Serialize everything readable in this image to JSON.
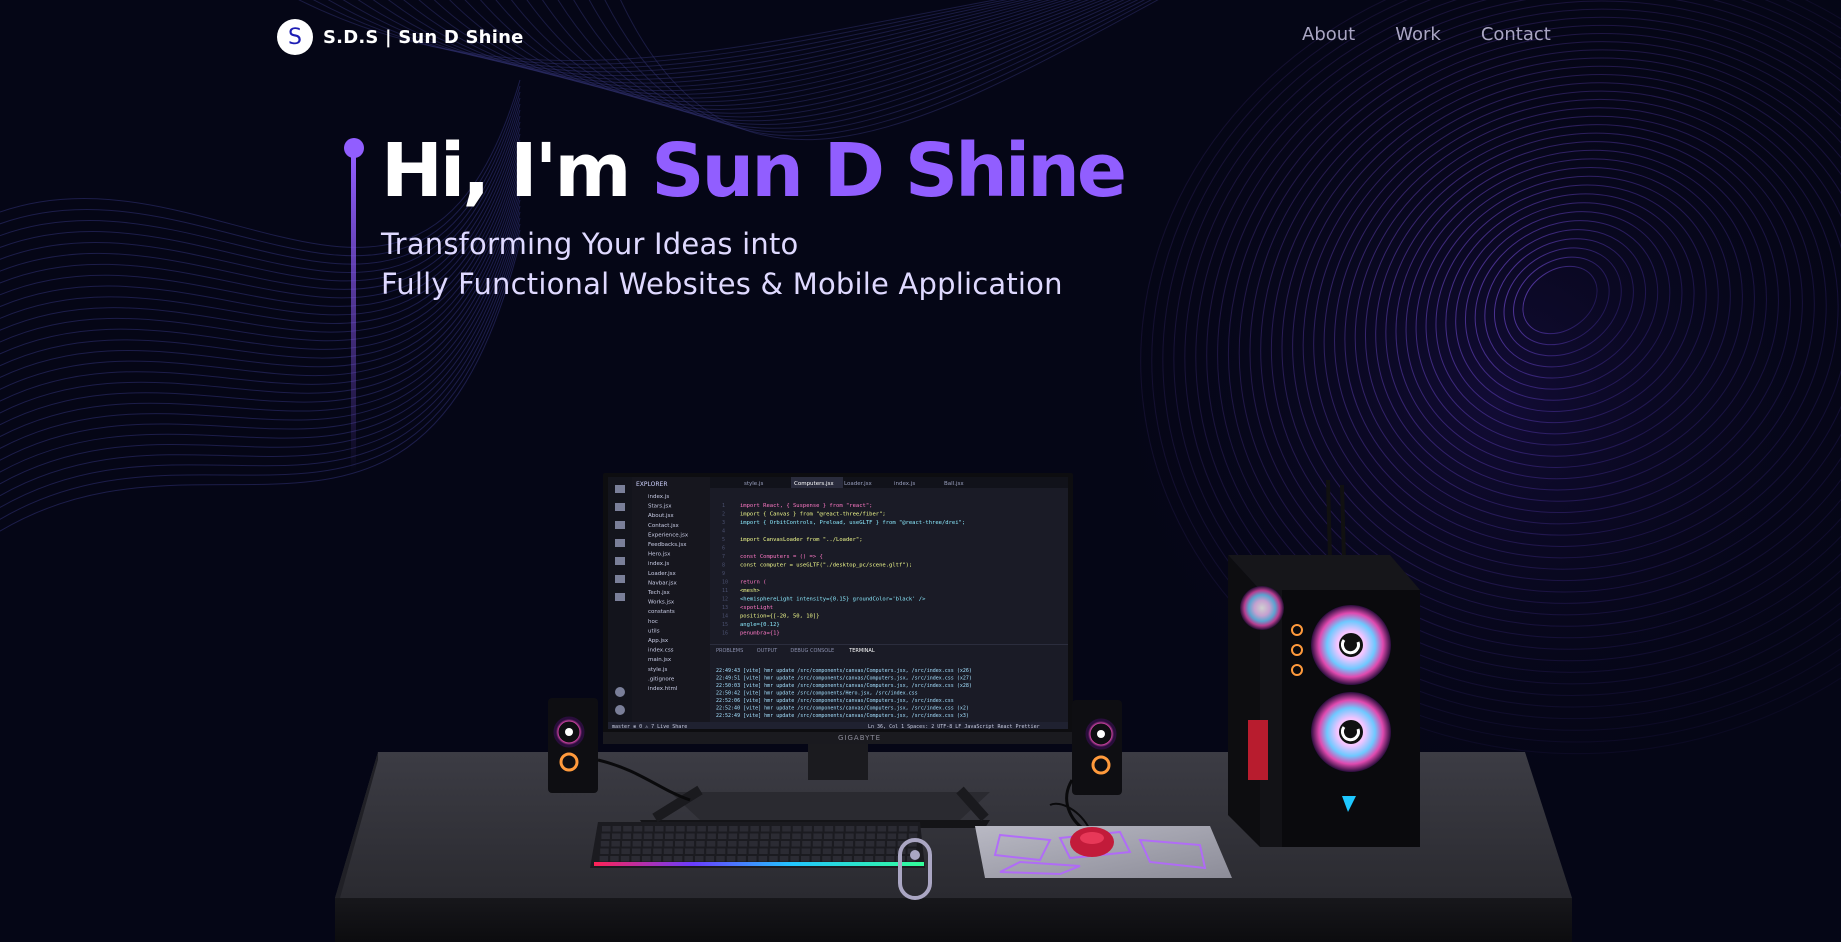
{
  "nav": {
    "logo_letter": "S",
    "logo_text": "S.D.S  | Sun D Shine",
    "links": [
      "About",
      "Work",
      "Contact"
    ]
  },
  "hero": {
    "greeting": "Hi, I'm ",
    "name": "Sun D Shine",
    "subtitle_line1": "Transforming Your Ideas into",
    "subtitle_line2": "Fully Functional Websites & Mobile Application"
  },
  "monitor": {
    "brand": "GIGABYTE",
    "explorer_title": "EXPLORER",
    "tabs": [
      "style.js",
      "Computers.jsx",
      "Loader.jsx",
      "index.js",
      "Ball.jsx"
    ],
    "files": [
      "index.js",
      "Stars.jsx",
      "About.jsx",
      "Contact.jsx",
      "Experience.jsx",
      "Feedbacks.jsx",
      "Hero.jsx",
      "index.js",
      "Loader.jsx",
      "Navbar.jsx",
      "Tech.jsx",
      "Works.jsx",
      "constants",
      "hoc",
      "utils",
      "App.jsx",
      "index.css",
      "main.jsx",
      "style.js",
      ".gitignore",
      "index.html"
    ],
    "code": [
      "import React, { Suspense } from \"react\";",
      "import { Canvas } from \"@react-three/fiber\";",
      "import { OrbitControls, Preload, useGLTF } from \"@react-three/drei\";",
      "",
      "import CanvasLoader from \"../Loader\";",
      "",
      "const Computers = () => {",
      "  const computer = useGLTF(\"./desktop_pc/scene.gltf\");",
      "",
      "  return (",
      "    <mesh>",
      "      <hemisphereLight intensity={0.15} groundColor='black' />",
      "      <spotLight",
      "        position={[-20, 50, 10]}",
      "        angle={0.12}",
      "        penumbra={1}"
    ],
    "panel_tabs": [
      "PROBLEMS",
      "OUTPUT",
      "DEBUG CONSOLE",
      "TERMINAL"
    ],
    "terminal": [
      "22:49:43 [vite] hmr update /src/components/canvas/Computers.jsx, /src/index.css (x26)",
      "22:49:51 [vite] hmr update /src/components/canvas/Computers.jsx, /src/index.css (x27)",
      "22:50:03 [vite] hmr update /src/components/canvas/Computers.jsx, /src/index.css (x28)",
      "22:50:42 [vite] hmr update /src/components/Hero.jsx, /src/index.css",
      "22:52:06 [vite] hmr update /src/components/canvas/Computers.jsx, /src/index.css",
      "22:52:40 [vite] hmr update /src/components/canvas/Computers.jsx, /src/index.css (x2)",
      "22:52:49 [vite] hmr update /src/components/canvas/Computers.jsx, /src/index.css (x3)"
    ],
    "status_left": "master  ⊗ 0 ⚠ 7  Live Share",
    "status_right": "Ln 36, Col 1   Spaces: 2   UTF-8   LF   JavaScript React   Prettier"
  },
  "colors": {
    "background": "#050616",
    "accent": "#915eff",
    "nav_link": "#aaa6c3",
    "subtitle": "#dfd9ff"
  }
}
